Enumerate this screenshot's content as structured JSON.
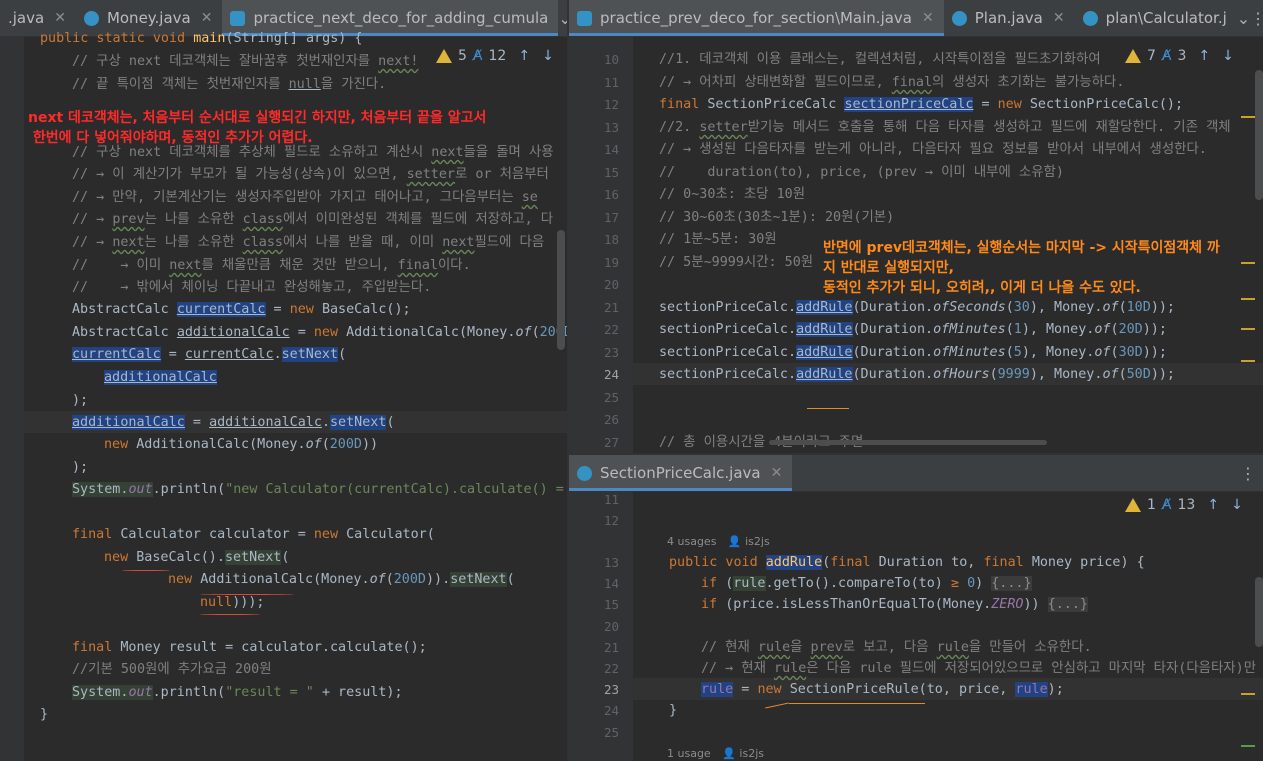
{
  "left": {
    "tabs": [
      {
        "label": ".java"
      },
      {
        "label": "Money.java"
      },
      {
        "label": "practice_next_deco_for_adding_cumula"
      }
    ],
    "inspection": {
      "warnings": "5",
      "typos": "12"
    },
    "gutter": [],
    "note": "next 데코객체는, 처음부터 순서대로 실행되긴 하지만, 처음부터 끝을 알고서\n 한번에 다 넣어줘야하며, 동적인 추가가 어렵다."
  },
  "right_top": {
    "tabs": [
      {
        "label": "practice_prev_deco_for_section\\Main.java"
      },
      {
        "label": "Plan.java"
      },
      {
        "label": "plan\\Calculator.j"
      }
    ],
    "inspection": {
      "warnings": "7",
      "typos": "3"
    },
    "line_numbers": [
      "10",
      "11",
      "12",
      "13",
      "14",
      "15",
      "16",
      "17",
      "18",
      "19",
      "20",
      "21",
      "22",
      "23",
      "24",
      "25",
      "26",
      "27"
    ],
    "note": "반면에 prev데코객체는, 실행순서는 마지막 -> 시작특이점객체 까\n지 반대로 실행되지만,\n동적인 추가가 되니, 오히려,, 이게 더 나을 수도 있다."
  },
  "right_bottom": {
    "tabs": [
      {
        "label": "SectionPriceCalc.java"
      }
    ],
    "inspection": {
      "warnings": "1",
      "typos": "13"
    },
    "line_numbers": [
      "11",
      "12",
      "13",
      "14",
      "15",
      "20",
      "21",
      "22",
      "23",
      "24",
      "25"
    ],
    "usages1": "4 usages",
    "author1": "is2js",
    "usages2": "1 usage",
    "author2": "is2js"
  }
}
